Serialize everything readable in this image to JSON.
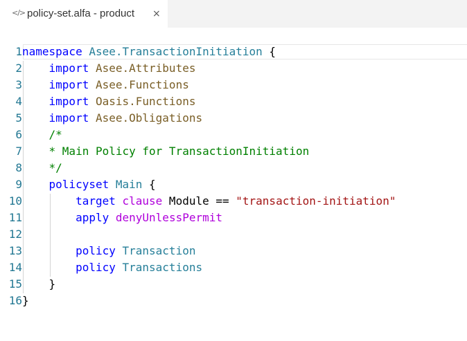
{
  "tab": {
    "icon": "code-file-icon",
    "title": "policy-set.alfa - product",
    "close": "×"
  },
  "lines": [
    {
      "n": "1",
      "tokens": [
        {
          "t": "namespace",
          "c": "kw"
        },
        {
          "t": " "
        },
        {
          "t": "Asee.TransactionInitiation",
          "c": "ty"
        },
        {
          "t": " {"
        }
      ]
    },
    {
      "n": "2",
      "tokens": [
        {
          "t": "    "
        },
        {
          "t": "import",
          "c": "kw"
        },
        {
          "t": " "
        },
        {
          "t": "Asee.Attributes",
          "c": "id"
        }
      ]
    },
    {
      "n": "3",
      "tokens": [
        {
          "t": "    "
        },
        {
          "t": "import",
          "c": "kw"
        },
        {
          "t": " "
        },
        {
          "t": "Asee.Functions",
          "c": "id"
        }
      ]
    },
    {
      "n": "4",
      "tokens": [
        {
          "t": "    "
        },
        {
          "t": "import",
          "c": "kw"
        },
        {
          "t": " "
        },
        {
          "t": "Oasis.Functions",
          "c": "id"
        }
      ]
    },
    {
      "n": "5",
      "tokens": [
        {
          "t": "    "
        },
        {
          "t": "import",
          "c": "kw"
        },
        {
          "t": " "
        },
        {
          "t": "Asee.Obligations",
          "c": "id"
        }
      ]
    },
    {
      "n": "6",
      "tokens": [
        {
          "t": "    "
        },
        {
          "t": "/*",
          "c": "cm"
        }
      ]
    },
    {
      "n": "7",
      "tokens": [
        {
          "t": "    "
        },
        {
          "t": "* Main Policy for TransactionInitiation",
          "c": "cm"
        }
      ]
    },
    {
      "n": "8",
      "tokens": [
        {
          "t": "    "
        },
        {
          "t": "*/",
          "c": "cm"
        }
      ]
    },
    {
      "n": "9",
      "tokens": [
        {
          "t": "    "
        },
        {
          "t": "policyset",
          "c": "kw"
        },
        {
          "t": " "
        },
        {
          "t": "Main",
          "c": "ty"
        },
        {
          "t": " {"
        }
      ]
    },
    {
      "n": "10",
      "tokens": [
        {
          "t": "        "
        },
        {
          "t": "target",
          "c": "kw"
        },
        {
          "t": " "
        },
        {
          "t": "clause",
          "c": "fn"
        },
        {
          "t": " Module == "
        },
        {
          "t": "\"transaction-initiation\"",
          "c": "st"
        }
      ]
    },
    {
      "n": "11",
      "tokens": [
        {
          "t": "        "
        },
        {
          "t": "apply",
          "c": "kw"
        },
        {
          "t": " "
        },
        {
          "t": "denyUnlessPermit",
          "c": "fn"
        }
      ]
    },
    {
      "n": "12",
      "tokens": []
    },
    {
      "n": "13",
      "tokens": [
        {
          "t": "        "
        },
        {
          "t": "policy",
          "c": "kw"
        },
        {
          "t": " "
        },
        {
          "t": "Transaction",
          "c": "ty"
        }
      ]
    },
    {
      "n": "14",
      "tokens": [
        {
          "t": "        "
        },
        {
          "t": "policy",
          "c": "kw"
        },
        {
          "t": " "
        },
        {
          "t": "Transactions",
          "c": "ty"
        }
      ]
    },
    {
      "n": "15",
      "tokens": [
        {
          "t": "    }"
        }
      ]
    },
    {
      "n": "16",
      "tokens": [
        {
          "t": "}"
        }
      ]
    }
  ]
}
